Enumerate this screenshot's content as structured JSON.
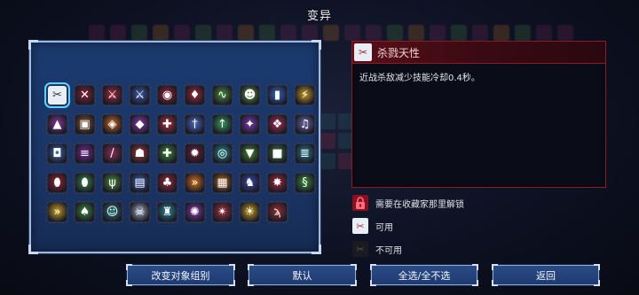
{
  "screen": {
    "title": "变异"
  },
  "colors": {
    "panel_bg": "#1c3566",
    "panel_border": "#9fb7d8",
    "detail_border": "#8a1c2a",
    "detail_header": "#5a0f18",
    "button_bg": "#1e3b70",
    "selection_outline": "#5fd0ff"
  },
  "mutations": [
    {
      "icon": "killer-instinct-icon",
      "glyph": "✂",
      "tint": "#c8d4e4",
      "selected": true
    },
    {
      "icon": "crossed-blades-icon",
      "glyph": "✕",
      "tint": "#8a2030"
    },
    {
      "icon": "red-blade-icon",
      "glyph": "⚔",
      "tint": "#a0283a"
    },
    {
      "icon": "blue-sword-icon",
      "glyph": "⚔",
      "tint": "#3a58a8"
    },
    {
      "icon": "red-orb-icon",
      "glyph": "◉",
      "tint": "#9a2030"
    },
    {
      "icon": "red-bottle-icon",
      "glyph": "♦",
      "tint": "#a02838"
    },
    {
      "icon": "snake-icon",
      "glyph": "∿",
      "tint": "#4a8a3a"
    },
    {
      "icon": "green-skull-icon",
      "glyph": "☻",
      "tint": "#5a9a3a"
    },
    {
      "icon": "blue-potion-icon",
      "glyph": "▮",
      "tint": "#3a6ac8"
    },
    {
      "icon": "lightning-icon",
      "glyph": "⚡",
      "tint": "#c89a20"
    },
    {
      "icon": "purple-hat-icon",
      "glyph": "▲",
      "tint": "#8a3a9a"
    },
    {
      "icon": "brown-bag-icon",
      "glyph": "▣",
      "tint": "#8a5a30"
    },
    {
      "icon": "orange-wave-icon",
      "glyph": "◈",
      "tint": "#c86a20"
    },
    {
      "icon": "purple-crystal-icon",
      "glyph": "◆",
      "tint": "#8a3ab0"
    },
    {
      "icon": "red-heart-icon",
      "glyph": "✚",
      "tint": "#b03040"
    },
    {
      "icon": "twin-daggers-icon",
      "glyph": "†",
      "tint": "#4a6ac0"
    },
    {
      "icon": "green-arrow-icon",
      "glyph": "↑",
      "tint": "#3a9a5a"
    },
    {
      "icon": "purple-star-icon",
      "glyph": "✦",
      "tint": "#7a3aa8"
    },
    {
      "icon": "red-beast-icon",
      "glyph": "❖",
      "tint": "#a83050"
    },
    {
      "icon": "music-note-icon",
      "glyph": "♫",
      "tint": "#6a6aa8"
    },
    {
      "icon": "blue-shield-icon",
      "glyph": "◘",
      "tint": "#3a6ab0"
    },
    {
      "icon": "purple-stripe-icon",
      "glyph": "≡",
      "tint": "#7a2a9a"
    },
    {
      "icon": "dagger-icon",
      "glyph": "/",
      "tint": "#8a3050"
    },
    {
      "icon": "red-mask-icon",
      "glyph": "☗",
      "tint": "#a83838"
    },
    {
      "icon": "green-cross-icon",
      "glyph": "✚",
      "tint": "#3a8a3a"
    },
    {
      "icon": "dark-spider-icon",
      "glyph": "✹",
      "tint": "#6a2030"
    },
    {
      "icon": "teal-eye-icon",
      "glyph": "◎",
      "tint": "#2a8a8a"
    },
    {
      "icon": "green-shield-icon",
      "glyph": "▼",
      "tint": "#4a8a2a"
    },
    {
      "icon": "green-tome-icon",
      "glyph": "■",
      "tint": "#3a7a3a"
    },
    {
      "icon": "teal-scroll-icon",
      "glyph": "≣",
      "tint": "#2a7a8a"
    },
    {
      "icon": "red-potion-icon",
      "glyph": "⬮",
      "tint": "#a02030"
    },
    {
      "icon": "green-vial-icon",
      "glyph": "⬮",
      "tint": "#3a8a4a"
    },
    {
      "icon": "green-claw-icon",
      "glyph": "ψ",
      "tint": "#4a8a3a"
    },
    {
      "icon": "blue-armor-icon",
      "glyph": "▤",
      "tint": "#3a5aa8"
    },
    {
      "icon": "red-flask-icon",
      "glyph": "♣",
      "tint": "#a02838"
    },
    {
      "icon": "orange-chevrons-icon",
      "glyph": "»",
      "tint": "#d0701a"
    },
    {
      "icon": "orange-chest-icon",
      "glyph": "▦",
      "tint": "#b06a20"
    },
    {
      "icon": "blue-knight-icon",
      "glyph": "♞",
      "tint": "#3a4aa8"
    },
    {
      "icon": "red-demon-icon",
      "glyph": "✸",
      "tint": "#a82838"
    },
    {
      "icon": "green-serpent-icon",
      "glyph": "§",
      "tint": "#3a8a3a"
    },
    {
      "icon": "yellow-chevrons-icon",
      "glyph": "»",
      "tint": "#c8a020"
    },
    {
      "icon": "green-leaf-icon",
      "glyph": "♠",
      "tint": "#3a8a3a"
    },
    {
      "icon": "teal-mask-icon",
      "glyph": "☺",
      "tint": "#2a7a7a"
    },
    {
      "icon": "white-skull-icon",
      "glyph": "☠",
      "tint": "#9aa8b8"
    },
    {
      "icon": "teal-fortress-icon",
      "glyph": "♜",
      "tint": "#2a8a9a"
    },
    {
      "icon": "purple-gear-icon",
      "glyph": "✺",
      "tint": "#8a3aa8"
    },
    {
      "icon": "red-spiral-icon",
      "glyph": "✴",
      "tint": "#a83040"
    },
    {
      "icon": "gold-sun-icon",
      "glyph": "☀",
      "tint": "#c8a020"
    },
    {
      "icon": "red-claw-icon",
      "glyph": "ϡ",
      "tint": "#9a3030"
    }
  ],
  "detail": {
    "icon": "killer-instinct-icon",
    "glyph": "✂",
    "name": "杀戮天性",
    "description": "近战杀敌减少技能冷却0.4秒。"
  },
  "legend": [
    {
      "icon": "lock-icon",
      "glyph": "🔒",
      "label": "需要在收藏家那里解锁"
    },
    {
      "icon": "available-mutation-icon",
      "glyph": "✂",
      "label": "可用"
    },
    {
      "icon": "unavailable-mutation-icon",
      "glyph": "✂",
      "label": "不可用"
    }
  ],
  "buttons": {
    "change_target_group": "改变对象组别",
    "default": "默认",
    "toggle_all": "全选/全不选",
    "back": "返回"
  }
}
